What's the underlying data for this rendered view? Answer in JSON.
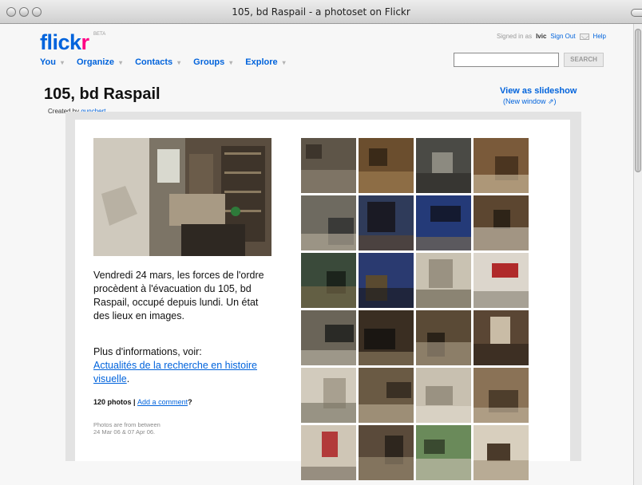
{
  "window": {
    "title": "105, bd Raspail - a photoset on Flickr"
  },
  "logo": {
    "main": "flick",
    "accent": "r",
    "beta": "BETA"
  },
  "nav": {
    "items": [
      "You",
      "Organize",
      "Contacts",
      "Groups",
      "Explore"
    ],
    "arrow": "▾"
  },
  "account": {
    "signed_in_as": "Signed in as",
    "username": "Ivic",
    "sign_out": "Sign Out",
    "help": "Help"
  },
  "search": {
    "button": "SEARCH",
    "value": ""
  },
  "set": {
    "title": "105, bd Raspail",
    "created_prefix": "Created by",
    "creator": "gunchert",
    "created_suffix": ".",
    "slideshow": "View as slideshow",
    "new_window": "(New window ⇗)"
  },
  "description": {
    "text": "Vendredi 24 mars, les forces de l'ordre procèdent à l'évacuation du 105, bd Raspail, occupé depuis lundi. Un état des lieux en images.",
    "more_prefix": "Plus d'informations, voir:",
    "link": "Actualités de la recherche en histoire visuelle",
    "link_suffix": "."
  },
  "stats": {
    "count": "120 photos",
    "separator": " | ",
    "comment_link": "Add a comment",
    "comment_suffix": "?",
    "dates_line1": "Photos are from between",
    "dates_line2": "24 Mar 06 & 07 Apr 06."
  },
  "colors": {
    "flickr_blue": "#0063dc",
    "flickr_pink": "#ff0084"
  },
  "thumbnail_count": 24
}
